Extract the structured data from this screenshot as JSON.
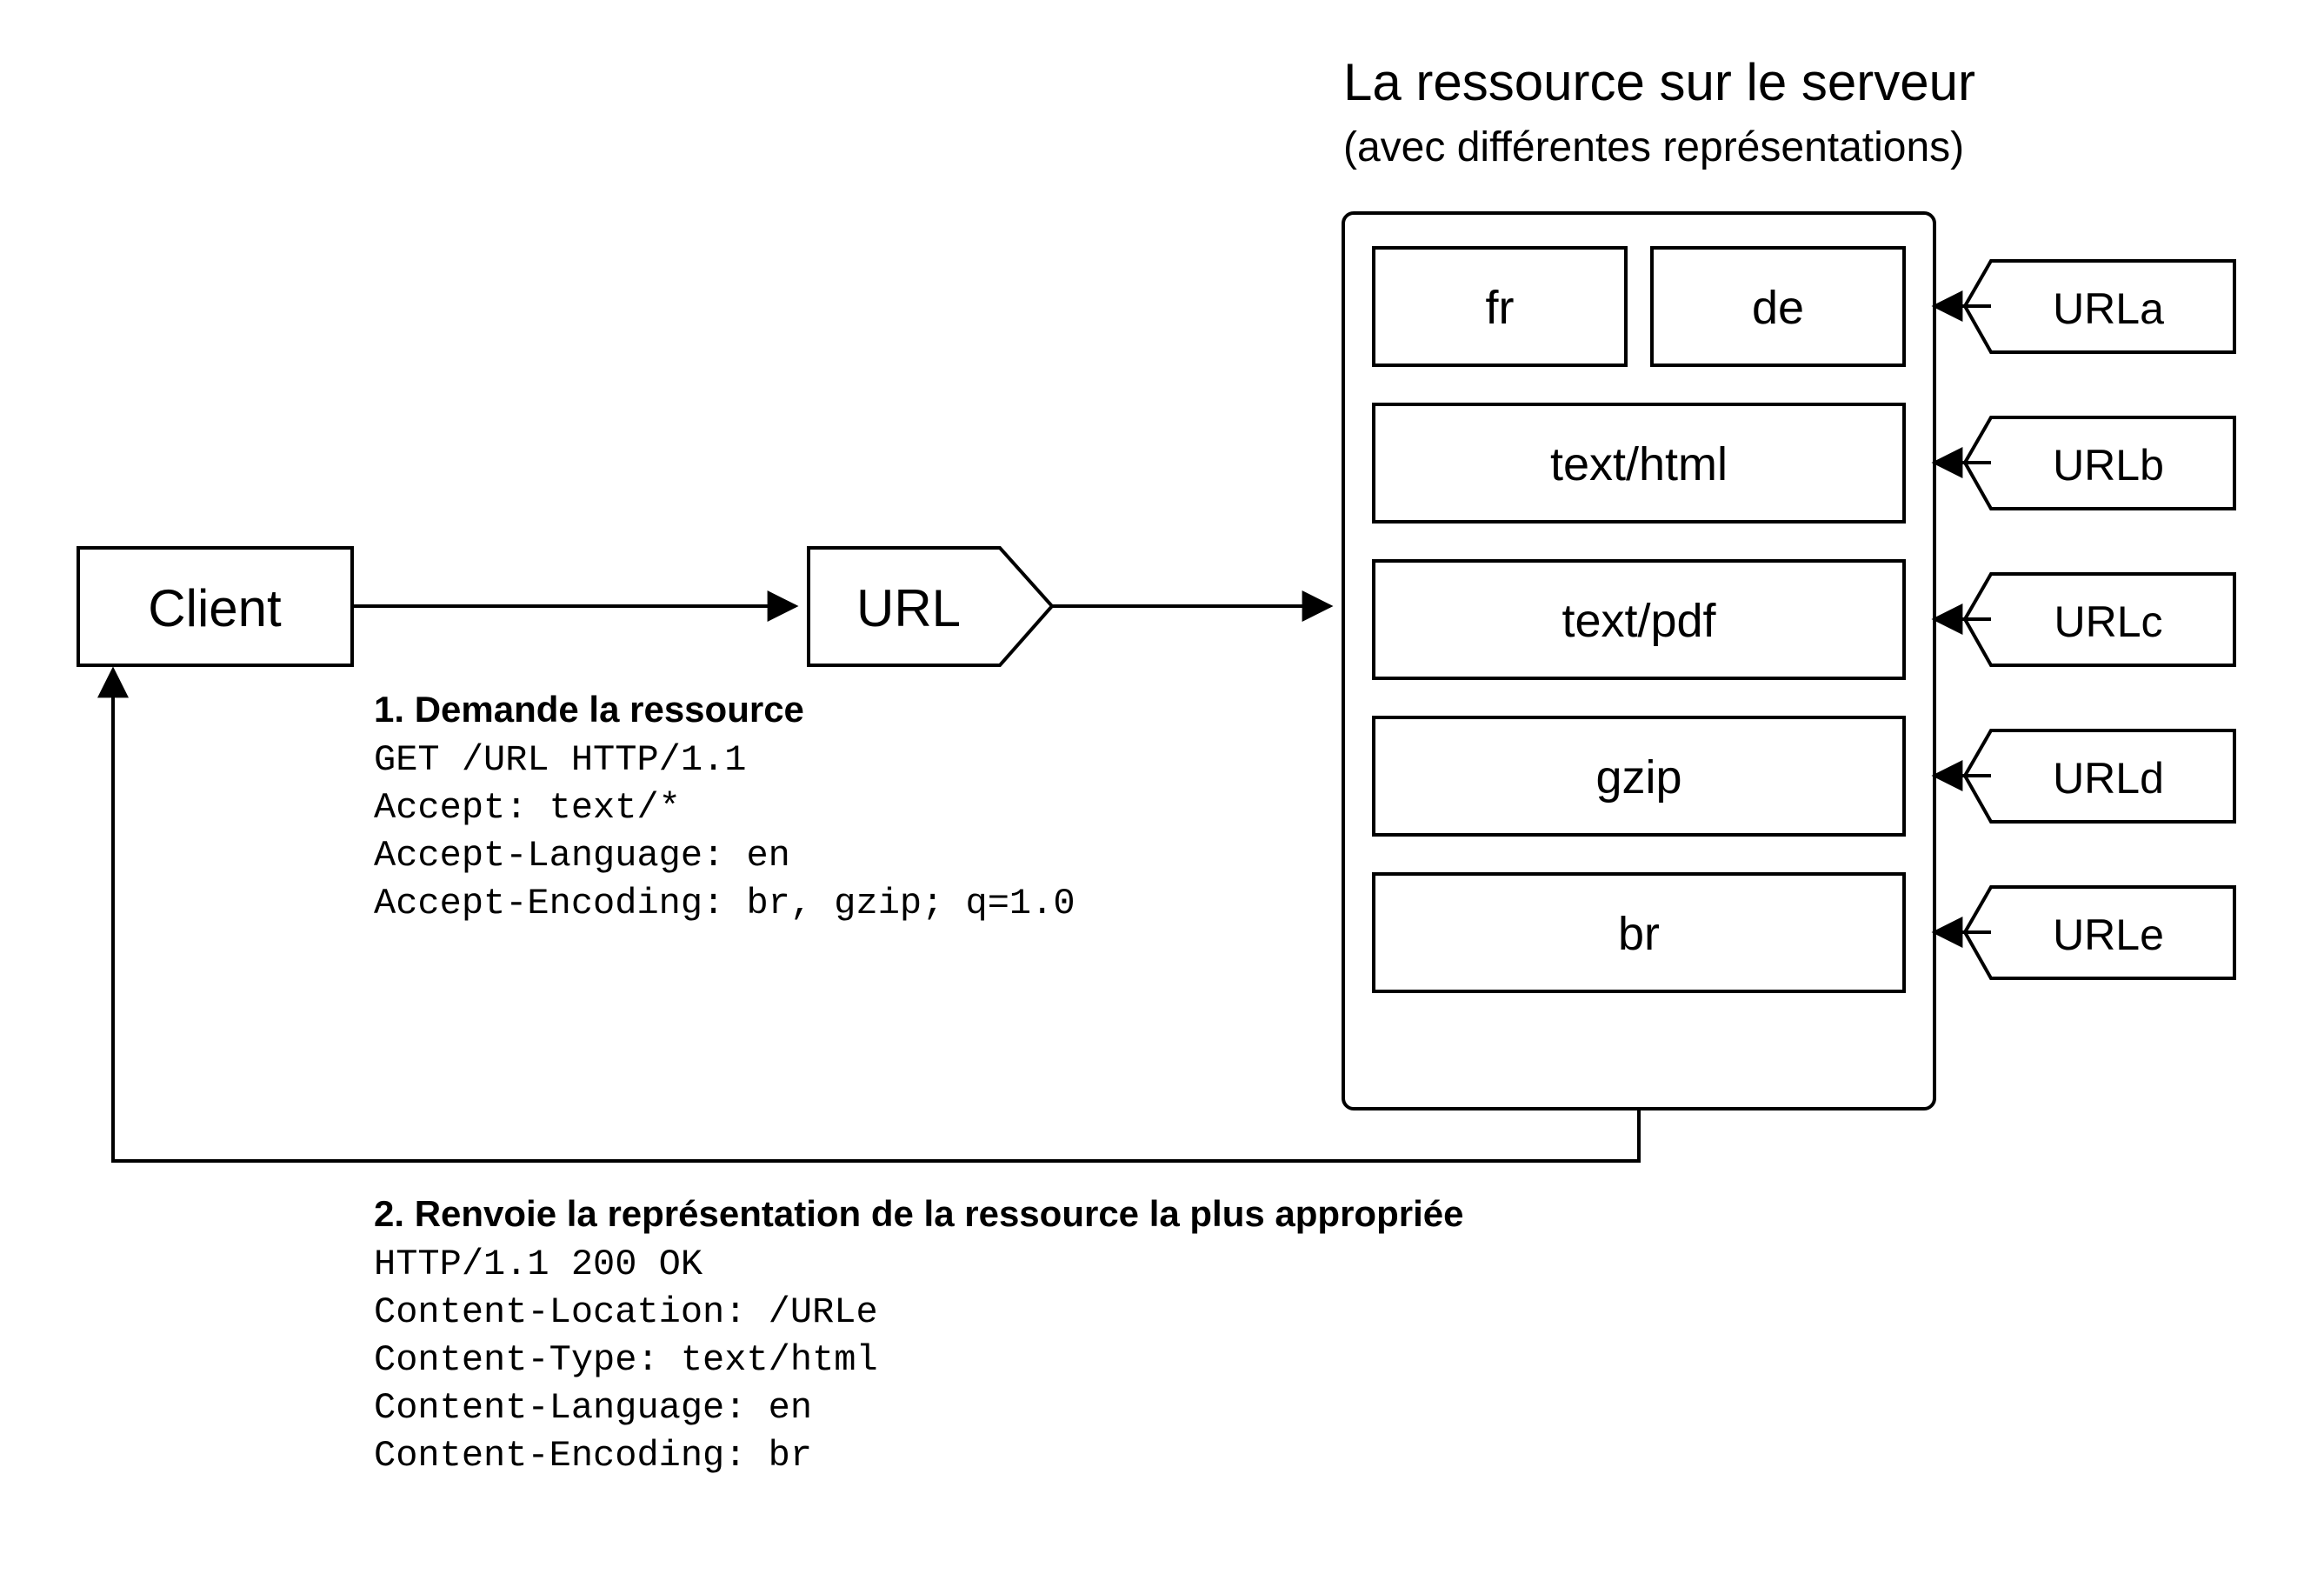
{
  "client": {
    "label": "Client"
  },
  "url_node": {
    "label": "URL"
  },
  "server_title": "La ressource sur le serveur",
  "server_subtitle": "(avec différentes représentations)",
  "resources": {
    "lang_fr": "fr",
    "lang_de": "de",
    "type_html": "text/html",
    "type_pdf": "text/pdf",
    "enc_gzip": "gzip",
    "enc_br": "br"
  },
  "url_tags": {
    "a": "URLa",
    "b": "URLb",
    "c": "URLc",
    "d": "URLd",
    "e": "URLe"
  },
  "request": {
    "heading": "1. Demande la ressource",
    "lines": [
      "GET /URL HTTP/1.1",
      "Accept: text/*",
      "Accept-Language: en",
      "Accept-Encoding: br, gzip; q=1.0"
    ]
  },
  "response": {
    "heading": "2. Renvoie la représentation de la ressource la plus appropriée",
    "lines": [
      "HTTP/1.1 200 OK",
      "Content-Location: /URLe",
      "Content-Type: text/html",
      "Content-Language: en",
      "Content-Encoding: br"
    ]
  }
}
